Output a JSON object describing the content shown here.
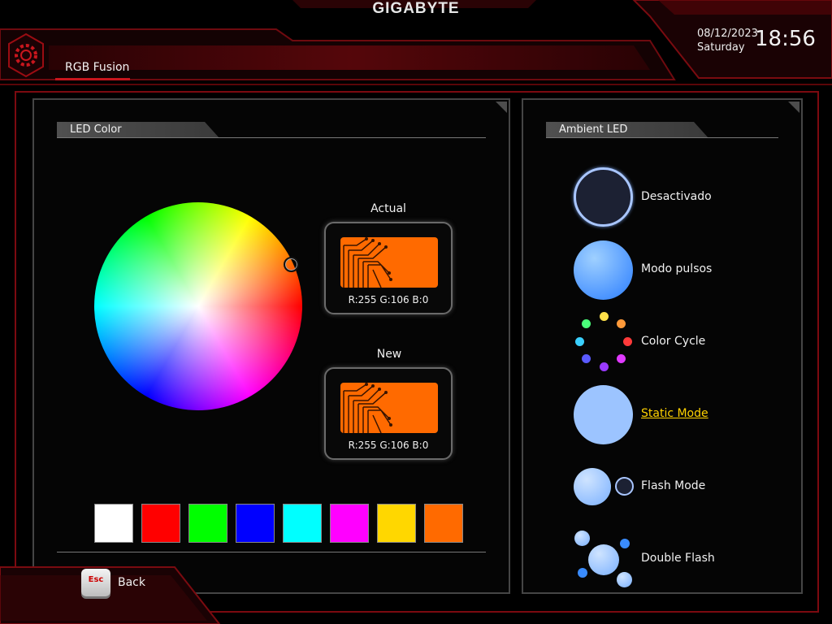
{
  "header": {
    "brand": "GIGABYTE",
    "app_title": "RGB Fusion",
    "date": "08/12/2023",
    "weekday": "Saturday",
    "time": "18:56"
  },
  "led_color": {
    "section_title": "LED Color",
    "actual": {
      "label": "Actual",
      "value": "R:255 G:106 B:0",
      "color": "#ff6a00"
    },
    "new": {
      "label": "New",
      "value": "R:255 G:106 B:0",
      "color": "#ff6a00"
    },
    "palette": [
      {
        "name": "white",
        "color": "#ffffff"
      },
      {
        "name": "red",
        "color": "#ff0000"
      },
      {
        "name": "green",
        "color": "#00ff00"
      },
      {
        "name": "blue",
        "color": "#0000ff"
      },
      {
        "name": "cyan",
        "color": "#00ffff"
      },
      {
        "name": "magenta",
        "color": "#ff00ff"
      },
      {
        "name": "yellow",
        "color": "#ffd700"
      },
      {
        "name": "orange",
        "color": "#ff6a00"
      }
    ]
  },
  "ambient": {
    "section_title": "Ambient LED",
    "modes": [
      {
        "label": "Desactivado",
        "icon": "off-icon",
        "active": false
      },
      {
        "label": "Modo pulsos",
        "icon": "pulse-icon",
        "active": false
      },
      {
        "label": "Color Cycle",
        "icon": "color-cycle-icon",
        "active": false
      },
      {
        "label": "Static Mode",
        "icon": "static-icon",
        "active": true
      },
      {
        "label": "Flash Mode",
        "icon": "flash-icon",
        "active": false
      },
      {
        "label": "Double Flash",
        "icon": "double-flash-icon",
        "active": false
      }
    ]
  },
  "footer": {
    "esc_key": "Esc",
    "back_label": "Back"
  },
  "colors": {
    "accent_red": "#c8161d",
    "highlight": "#ffd200",
    "mode_blue": "#8ab8ff"
  }
}
